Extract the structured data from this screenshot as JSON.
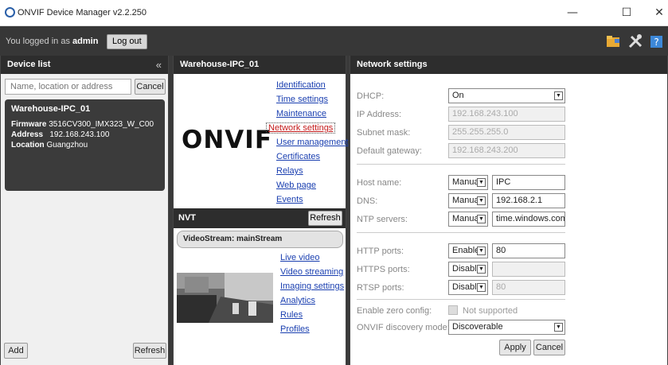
{
  "window": {
    "title": "ONVIF Device Manager v2.2.250",
    "controls": [
      "—",
      "☐",
      "✕"
    ]
  },
  "userbar": {
    "prefix": "You logged in as",
    "user": "admin",
    "logout": "Log out"
  },
  "device_list": {
    "title": "Device list",
    "collapse": "«",
    "search_placeholder": "Name, location or address",
    "cancel": "Cancel",
    "device": {
      "name": "Warehouse-IPC_01",
      "firmware_label": "Firmware",
      "firmware": "3516CV300_IMX323_W_C00",
      "address_label": "Address",
      "address": "192.168.243.100",
      "location_label": "Location",
      "location": "Guangzhou"
    },
    "add": "Add",
    "refresh": "Refresh"
  },
  "device_panel": {
    "title": "Warehouse-IPC_01",
    "logo": "ONVIF",
    "links": [
      "Identification",
      "Time settings",
      "Maintenance",
      "Network settings",
      "User management",
      "Certificates",
      "Relays",
      "Web page",
      "Events"
    ],
    "nvt": {
      "title": "NVT",
      "refresh": "Refresh",
      "stream": "VideoStream: mainStream",
      "links": [
        "Live video",
        "Video streaming",
        "Imaging settings",
        "Analytics",
        "Rules",
        "Profiles"
      ]
    }
  },
  "network": {
    "title": "Network settings",
    "dhcp": {
      "label": "DHCP:",
      "value": "On"
    },
    "ip": {
      "label": "IP Address:",
      "value": "192.168.243.100"
    },
    "mask": {
      "label": "Subnet mask:",
      "value": "255.255.255.0"
    },
    "gateway": {
      "label": "Default gateway:",
      "value": "192.168.243.200"
    },
    "host": {
      "label": "Host name:",
      "mode": "Manual",
      "value": "IPC"
    },
    "dns": {
      "label": "DNS:",
      "mode": "Manual",
      "value": "192.168.2.1"
    },
    "ntp": {
      "label": "NTP servers:",
      "mode": "Manual",
      "value": "time.windows.com"
    },
    "http": {
      "label": "HTTP ports:",
      "mode": "Enable",
      "value": "80"
    },
    "https": {
      "label": "HTTPS ports:",
      "mode": "Disable",
      "value": ""
    },
    "rtsp": {
      "label": "RTSP ports:",
      "mode": "Disable",
      "value": "80"
    },
    "zeroconf": {
      "label": "Enable zero config:",
      "value": "Not supported"
    },
    "discovery": {
      "label": "ONVIF discovery mode:",
      "value": "Discoverable"
    },
    "apply": "Apply",
    "cancel": "Cancel"
  }
}
